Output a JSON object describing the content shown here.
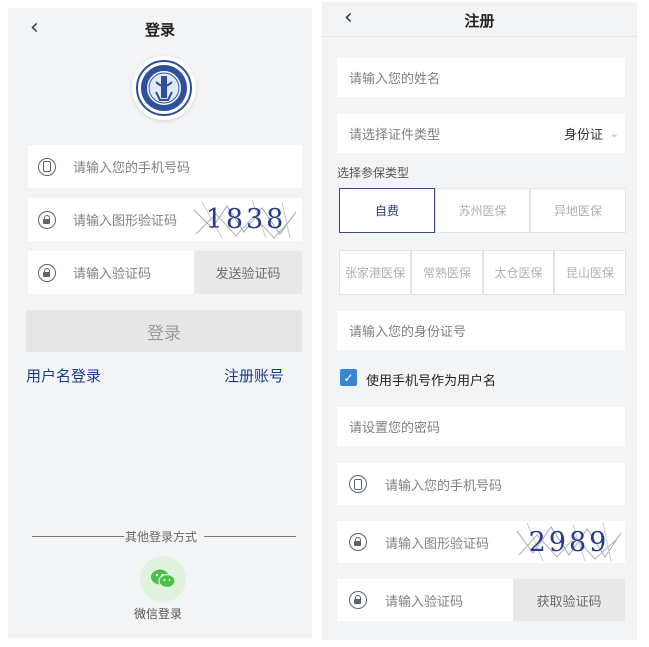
{
  "login": {
    "title": "登录",
    "back_icon": "chevron-left-icon",
    "phone_placeholder": "请输入您的手机号码",
    "captcha_placeholder": "请输入图形验证码",
    "captcha_code": "1838",
    "code_placeholder": "请输入验证码",
    "send_code_label": "发送验证码",
    "login_button": "登录",
    "username_login_link": "用户名登录",
    "register_link": "注册账号",
    "other_methods_label": "其他登录方式",
    "wechat_label": "微信登录"
  },
  "register": {
    "title": "注册",
    "back_icon": "chevron-left-icon",
    "name_placeholder": "请输入您的姓名",
    "id_type_label": "请选择证件类型",
    "id_type_value": "身份证",
    "insurance_section_label": "选择参保类型",
    "insurance_row1": [
      "自费",
      "苏州医保",
      "异地医保"
    ],
    "insurance_row2": [
      "张家港医保",
      "常熟医保",
      "太仓医保",
      "昆山医保"
    ],
    "selected_insurance": "自费",
    "id_number_placeholder": "请输入您的身份证号",
    "use_phone_checkbox_label": "使用手机号作为用户名",
    "use_phone_checked": true,
    "password_placeholder": "请设置您的密码",
    "phone_placeholder": "请输入您的手机号码",
    "captcha_placeholder": "请输入图形验证码",
    "captcha_code": "2989",
    "code_placeholder": "请输入验证码",
    "get_code_label": "获取验证码"
  },
  "colors": {
    "accent": "#1a3b8c",
    "checkbox": "#3a86d6",
    "wechat": "#4cbf4c"
  }
}
